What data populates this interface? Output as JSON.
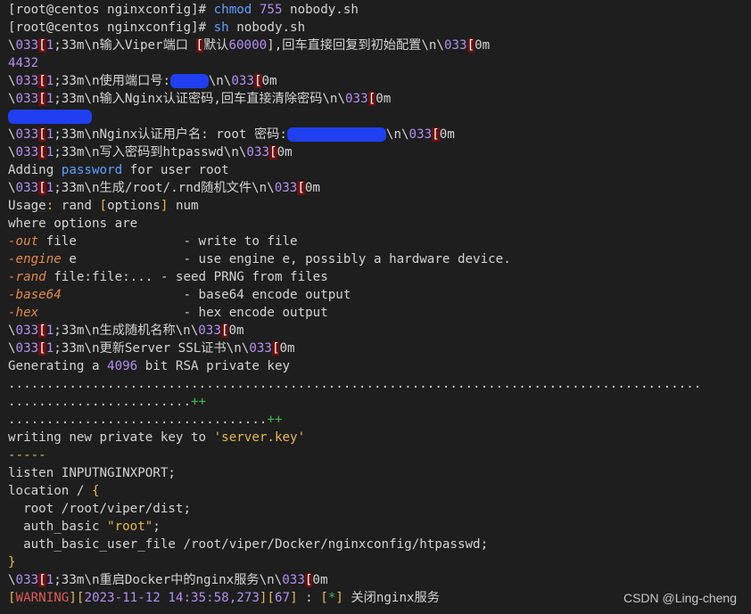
{
  "terminal": {
    "lines": [
      [
        {
          "t": "[root@centos nginxconfig]# ",
          "c": "prompt"
        },
        {
          "t": "chmod",
          "c": "cmd"
        },
        {
          "t": " ",
          "c": "default"
        },
        {
          "t": "755",
          "c": "num"
        },
        {
          "t": " nobody.sh",
          "c": "default"
        }
      ],
      [
        {
          "t": "[root@centos nginxconfig]# ",
          "c": "prompt"
        },
        {
          "t": "sh",
          "c": "cmd"
        },
        {
          "t": " nobody.sh",
          "c": "default"
        }
      ],
      [
        {
          "t": "\\",
          "c": "default"
        },
        {
          "t": "033",
          "c": "num"
        },
        {
          "t": "[",
          "c": "esc"
        },
        {
          "t": "1",
          "c": "num"
        },
        {
          "t": ";33m\\n输入Viper端口 ",
          "c": "default"
        },
        {
          "t": "[",
          "c": "esc"
        },
        {
          "t": "默认",
          "c": "default"
        },
        {
          "t": "60000",
          "c": "num"
        },
        {
          "t": "],回车直接回复到初始配置\\n\\",
          "c": "default"
        },
        {
          "t": "033",
          "c": "num"
        },
        {
          "t": "[",
          "c": "esc"
        },
        {
          "t": "0m",
          "c": "default"
        }
      ],
      [
        {
          "t": "4432",
          "c": "num"
        }
      ],
      [
        {
          "t": "\\",
          "c": "default"
        },
        {
          "t": "033",
          "c": "num"
        },
        {
          "t": "[",
          "c": "esc"
        },
        {
          "t": "1",
          "c": "num"
        },
        {
          "t": ";33m\\n使用端口号:",
          "c": "default"
        },
        {
          "t": "     ",
          "c": "redact"
        },
        {
          "t": "\\n\\",
          "c": "default"
        },
        {
          "t": "033",
          "c": "num"
        },
        {
          "t": "[",
          "c": "esc"
        },
        {
          "t": "0m",
          "c": "default"
        }
      ],
      [
        {
          "t": "\\",
          "c": "default"
        },
        {
          "t": "033",
          "c": "num"
        },
        {
          "t": "[",
          "c": "esc"
        },
        {
          "t": "1",
          "c": "num"
        },
        {
          "t": ";33m\\n输入Nginx认证密码,回车直接清除密码\\n\\",
          "c": "default"
        },
        {
          "t": "033",
          "c": "num"
        },
        {
          "t": "[",
          "c": "esc"
        },
        {
          "t": "0m",
          "c": "default"
        }
      ],
      [
        {
          "t": "           ",
          "c": "redact"
        }
      ],
      [
        {
          "t": "\\",
          "c": "default"
        },
        {
          "t": "033",
          "c": "num"
        },
        {
          "t": "[",
          "c": "esc"
        },
        {
          "t": "1",
          "c": "num"
        },
        {
          "t": ";33m\\nNginx认证用户名: root 密码:",
          "c": "default"
        },
        {
          "t": "             ",
          "c": "redact"
        },
        {
          "t": "\\n\\",
          "c": "default"
        },
        {
          "t": "033",
          "c": "num"
        },
        {
          "t": "[",
          "c": "esc"
        },
        {
          "t": "0m",
          "c": "default"
        }
      ],
      [
        {
          "t": "\\",
          "c": "default"
        },
        {
          "t": "033",
          "c": "num"
        },
        {
          "t": "[",
          "c": "esc"
        },
        {
          "t": "1",
          "c": "num"
        },
        {
          "t": ";33m\\n写入密码到htpasswd\\n\\",
          "c": "default"
        },
        {
          "t": "033",
          "c": "num"
        },
        {
          "t": "[",
          "c": "esc"
        },
        {
          "t": "0m",
          "c": "default"
        }
      ],
      [
        {
          "t": "Adding ",
          "c": "default"
        },
        {
          "t": "password",
          "c": "cmd"
        },
        {
          "t": " for user root",
          "c": "default"
        }
      ],
      [
        {
          "t": "\\",
          "c": "default"
        },
        {
          "t": "033",
          "c": "num"
        },
        {
          "t": "[",
          "c": "esc"
        },
        {
          "t": "1",
          "c": "num"
        },
        {
          "t": ";33m\\n生成/root/.rnd随机文件\\n\\",
          "c": "default"
        },
        {
          "t": "033",
          "c": "num"
        },
        {
          "t": "[",
          "c": "esc"
        },
        {
          "t": "0m",
          "c": "default"
        }
      ],
      [
        {
          "t": "Usage",
          "c": "default"
        },
        {
          "t": ":",
          "c": "str"
        },
        {
          "t": " rand ",
          "c": "default"
        },
        {
          "t": "[",
          "c": "str"
        },
        {
          "t": "options",
          "c": "default"
        },
        {
          "t": "]",
          "c": "str"
        },
        {
          "t": " num",
          "c": "default"
        }
      ],
      [
        {
          "t": "where options are",
          "c": "default"
        }
      ],
      [
        {
          "t": "-out",
          "c": "opt"
        },
        {
          "t": " file              - write to file",
          "c": "default"
        }
      ],
      [
        {
          "t": "-engine",
          "c": "opt"
        },
        {
          "t": " e              - use engine e, possibly a hardware device.",
          "c": "default"
        }
      ],
      [
        {
          "t": "-rand",
          "c": "opt"
        },
        {
          "t": " file:file:... - seed PRNG from files",
          "c": "default"
        }
      ],
      [
        {
          "t": "-base64",
          "c": "opt"
        },
        {
          "t": "                - base64 encode output",
          "c": "default"
        }
      ],
      [
        {
          "t": "-hex",
          "c": "opt"
        },
        {
          "t": "                   - hex encode output",
          "c": "default"
        }
      ],
      [
        {
          "t": "\\",
          "c": "default"
        },
        {
          "t": "033",
          "c": "num"
        },
        {
          "t": "[",
          "c": "esc"
        },
        {
          "t": "1",
          "c": "num"
        },
        {
          "t": ";33m\\n生成随机名称\\n\\",
          "c": "default"
        },
        {
          "t": "033",
          "c": "num"
        },
        {
          "t": "[",
          "c": "esc"
        },
        {
          "t": "0m",
          "c": "default"
        }
      ],
      [
        {
          "t": "\\",
          "c": "default"
        },
        {
          "t": "033",
          "c": "num"
        },
        {
          "t": "[",
          "c": "esc"
        },
        {
          "t": "1",
          "c": "num"
        },
        {
          "t": ";33m\\n更新Server SSL证书\\n\\",
          "c": "default"
        },
        {
          "t": "033",
          "c": "num"
        },
        {
          "t": "[",
          "c": "esc"
        },
        {
          "t": "0m",
          "c": "default"
        }
      ],
      [
        {
          "t": "Generating a ",
          "c": "default"
        },
        {
          "t": "4096",
          "c": "num"
        },
        {
          "t": " bit RSA private key",
          "c": "default"
        }
      ],
      [
        {
          "t": "...........................................................................................",
          "c": "default"
        }
      ],
      [
        {
          "t": "........................",
          "c": "default"
        },
        {
          "t": "++",
          "c": "green"
        }
      ],
      [
        {
          "t": "..................................",
          "c": "default"
        },
        {
          "t": "++",
          "c": "green"
        }
      ],
      [
        {
          "t": "writing new private key to ",
          "c": "default"
        },
        {
          "t": "'server.key'",
          "c": "str"
        }
      ],
      [
        {
          "t": "-----",
          "c": "str"
        }
      ],
      [
        {
          "t": "listen INPUTNGINXPORT;",
          "c": "default"
        }
      ],
      [
        {
          "t": "location / ",
          "c": "default"
        },
        {
          "t": "{",
          "c": "str"
        }
      ],
      [
        {
          "t": "  root /root/viper/dist;",
          "c": "default"
        }
      ],
      [
        {
          "t": "  auth_basic ",
          "c": "default"
        },
        {
          "t": "\"root\"",
          "c": "str"
        },
        {
          "t": ";",
          "c": "default"
        }
      ],
      [
        {
          "t": "  auth_basic_user_file /root/viper/Docker/nginxconfig/htpasswd;",
          "c": "default"
        }
      ],
      [
        {
          "t": "}",
          "c": "str"
        }
      ],
      [
        {
          "t": "\\",
          "c": "default"
        },
        {
          "t": "033",
          "c": "num"
        },
        {
          "t": "[",
          "c": "esc"
        },
        {
          "t": "1",
          "c": "num"
        },
        {
          "t": ";33m\\n重启Docker中的nginx服务\\n\\",
          "c": "default"
        },
        {
          "t": "033",
          "c": "num"
        },
        {
          "t": "[",
          "c": "esc"
        },
        {
          "t": "0m",
          "c": "default"
        }
      ],
      [
        {
          "t": "[",
          "c": "str"
        },
        {
          "t": "WARNING",
          "c": "red"
        },
        {
          "t": "][",
          "c": "str"
        },
        {
          "t": "2023-11-12 14:35:58,273",
          "c": "num"
        },
        {
          "t": "][",
          "c": "str"
        },
        {
          "t": "67",
          "c": "num"
        },
        {
          "t": "]",
          "c": "str"
        },
        {
          "t": " : ",
          "c": "default"
        },
        {
          "t": "[",
          "c": "str"
        },
        {
          "t": "*",
          "c": "green"
        },
        {
          "t": "]",
          "c": "str"
        },
        {
          "t": " 关闭nginx服务",
          "c": "default"
        }
      ]
    ]
  },
  "watermark": {
    "text": "CSDN @Ling-cheng"
  }
}
